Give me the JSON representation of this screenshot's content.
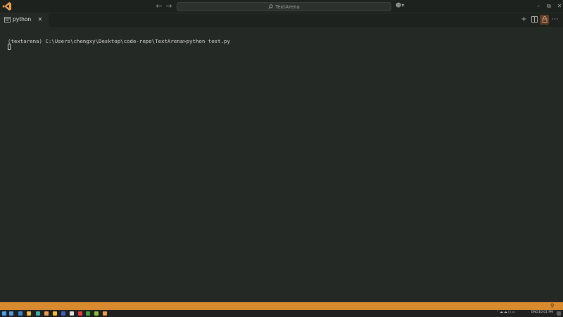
{
  "titlebar": {
    "search_text": "TextArena",
    "icons": [
      "vscode-logo",
      "arrow-left-icon",
      "arrow-right-icon",
      "search-icon",
      "copilot-icon",
      "minimize-icon",
      "maximize-icon",
      "close-icon"
    ]
  },
  "tabs": [
    {
      "label": "python",
      "active": true
    }
  ],
  "tab_actions": [
    "new-terminal-icon",
    "split-editor-icon",
    "lock-icon",
    "more-icon"
  ],
  "terminal": {
    "prompt": "(textarena) C:\\Users\\chengxy\\Desktop\\code-repo\\TextArena>python test.py"
  },
  "taskbar": {
    "tray": {
      "lang": "ENG",
      "time": "10:01 PM"
    }
  },
  "colors": {
    "background": "#252925",
    "titlebar": "#1e221e",
    "statusbar": "#d98a2e",
    "accent": "#e0a070"
  }
}
